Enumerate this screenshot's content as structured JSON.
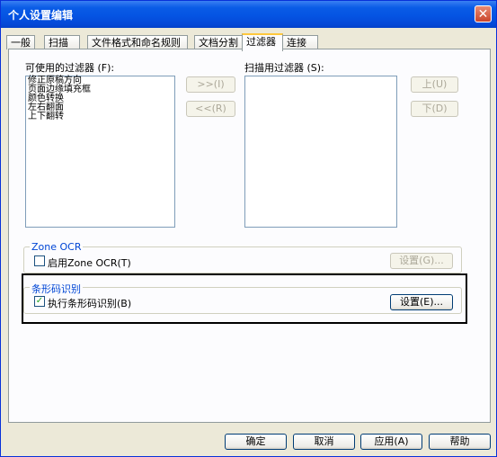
{
  "window": {
    "title": "个人设置编辑",
    "close": "✕"
  },
  "tabs": [
    {
      "label": "一般"
    },
    {
      "label": "扫描"
    },
    {
      "label": "文件格式和命名规则"
    },
    {
      "label": "文档分割"
    },
    {
      "label": "过滤器"
    },
    {
      "label": "连接"
    }
  ],
  "active_tab": "过滤器",
  "available": {
    "label": "可使用的过滤器 (F):",
    "items": [
      "修正原稿方向",
      "页面边缘填充框",
      "颜色转换",
      "左右翻面",
      "上下翻转"
    ]
  },
  "move": {
    "add": ">>(I)",
    "remove": "<<(R)"
  },
  "scan": {
    "label": "扫描用过滤器 (S):",
    "up": "上(U)",
    "down": "下(D)"
  },
  "zone_ocr": {
    "title": "Zone OCR",
    "enable_label": "启用Zone OCR(T)",
    "enabled": false,
    "settings": "设置(G)..."
  },
  "barcode": {
    "title": "条形码识别",
    "enable_label": "执行条形码识别(B)",
    "enabled": true,
    "check_mark": "✓",
    "settings": "设置(E)..."
  },
  "footer": {
    "ok": "确定",
    "cancel": "取消",
    "apply": "应用(A)",
    "help": "帮助"
  }
}
